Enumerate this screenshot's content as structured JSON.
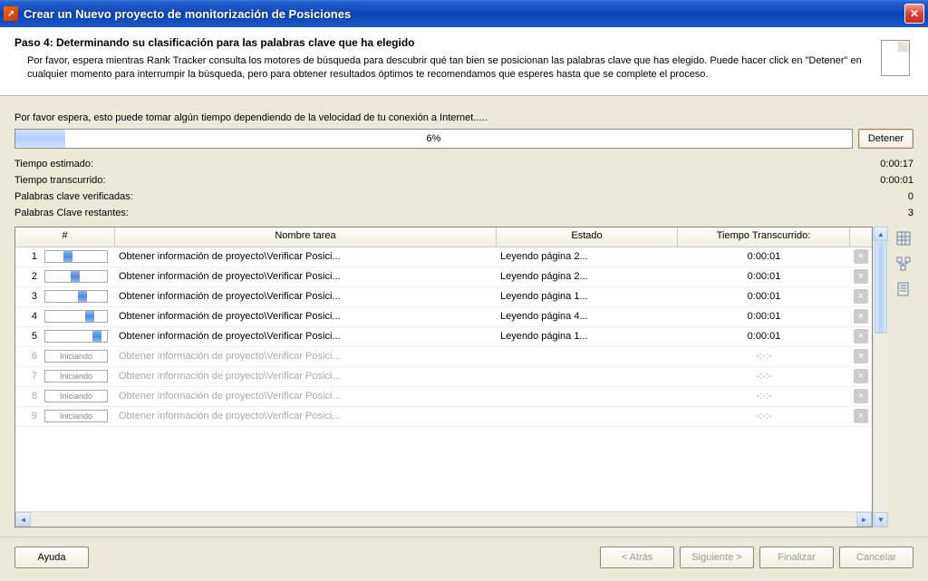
{
  "titlebar": {
    "text": "Crear un Nuevo proyecto de monitorización de Posiciones"
  },
  "header": {
    "step": "Paso 4: Determinando su clasificación para las palabras clave que ha elegido",
    "desc": "Por favor, espera mientras Rank Tracker consulta los motores de búsqueda para descubrir qué tan bien se posicionan las palabras clave que has elegido. Puede hacer click en \"Detener\" en cualquier momento para interrumpir la búsqueda, pero para obtener resultados óptimos te recomendamos que esperes hasta que se complete el proceso."
  },
  "wait_text": "Por favor espera, esto puede tomar algún tiempo dependiendo de la velocidad de tu conexión a Internet.....",
  "progress": {
    "percent": "6%",
    "fill_width": "6%",
    "stop": "Detener"
  },
  "stats": {
    "est_label": "Tiempo estimado:",
    "est_val": "0:00:17",
    "elapsed_label": "Tiempo transcurrido:",
    "elapsed_val": "0:00:01",
    "checked_label": "Palabras clave verificadas:",
    "checked_val": "0",
    "remain_label": "Palabras Clave restantes:",
    "remain_val": "3"
  },
  "table": {
    "headers": {
      "num": "#",
      "name": "Nombre tarea",
      "state": "Estado",
      "time": "Tiempo Transcurrido:"
    },
    "rows": [
      {
        "n": "1",
        "faded": false,
        "mini": "progress",
        "name": "Obtener información de proyecto\\Verificar Posici...",
        "state": "Leyendo página 2...",
        "time": "0:00:01"
      },
      {
        "n": "2",
        "faded": false,
        "mini": "progress",
        "name": "Obtener información de proyecto\\Verificar Posici...",
        "state": "Leyendo página 2...",
        "time": "0:00:01"
      },
      {
        "n": "3",
        "faded": false,
        "mini": "progress",
        "name": "Obtener información de proyecto\\Verificar Posici...",
        "state": "Leyendo página 1...",
        "time": "0:00:01"
      },
      {
        "n": "4",
        "faded": false,
        "mini": "progress",
        "name": "Obtener información de proyecto\\Verificar Posici...",
        "state": "Leyendo página 4...",
        "time": "0:00:01"
      },
      {
        "n": "5",
        "faded": false,
        "mini": "progress",
        "name": "Obtener información de proyecto\\Verificar Posici...",
        "state": "Leyendo página 1...",
        "time": "0:00:01"
      },
      {
        "n": "6",
        "faded": true,
        "mini": "Iniciando",
        "name": "Obtener información de proyecto\\Verificar Posici...",
        "state": "",
        "time": "-:-:-"
      },
      {
        "n": "7",
        "faded": true,
        "mini": "Iniciando",
        "name": "Obtener información de proyecto\\Verificar Posici...",
        "state": "",
        "time": "-:-:-"
      },
      {
        "n": "8",
        "faded": true,
        "mini": "Iniciando",
        "name": "Obtener información de proyecto\\Verificar Posici...",
        "state": "",
        "time": "-:-:-"
      },
      {
        "n": "9",
        "faded": true,
        "mini": "Iniciando",
        "name": "Obtener información de proyecto\\Verificar Posici...",
        "state": "",
        "time": "-:-:-"
      }
    ]
  },
  "footer": {
    "help": "Ayuda",
    "back": "< Atrás",
    "next": "Siguiente >",
    "finish": "Finalizar",
    "cancel": "Cancelar"
  }
}
